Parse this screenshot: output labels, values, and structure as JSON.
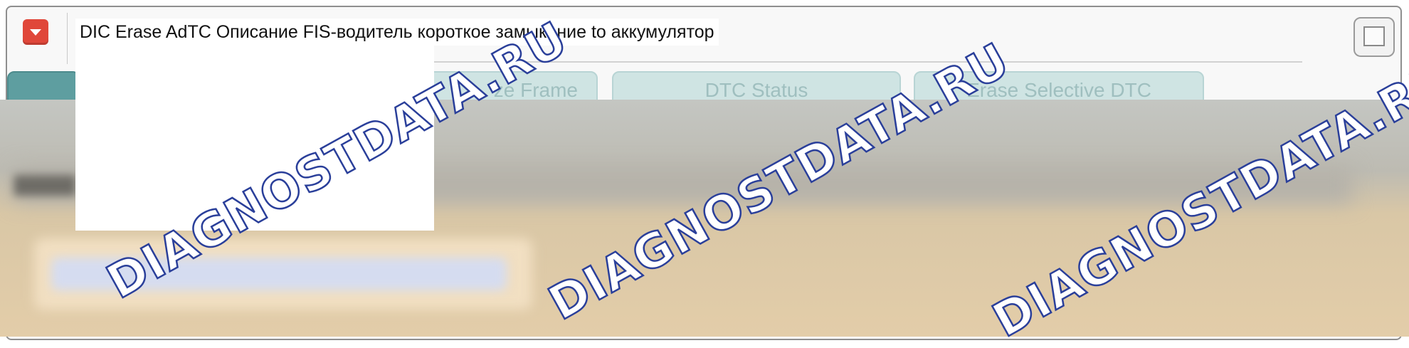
{
  "window": {
    "title": "DIC Erase AdTC Описание FIS-водитель короткое замыкание to аккумулятор",
    "menu_icon": "dropdown-arrow-icon",
    "maximize_icon": "maximize-window-icon"
  },
  "tabs": [
    {
      "label": "",
      "active": true
    },
    {
      "label": "ze Frame",
      "active": false
    },
    {
      "label": "DTC Status",
      "active": false
    },
    {
      "label": "Erase Selective DTC",
      "active": false
    }
  ],
  "watermark": {
    "text": "DIAGNOSTDATA.RU",
    "color": "#2a3f9a"
  },
  "colors": {
    "menu_button": "#e0473a",
    "tab_inactive": "#cfe4e3",
    "tab_active": "#5e9ea0",
    "content_bg": "#e3cda9"
  }
}
